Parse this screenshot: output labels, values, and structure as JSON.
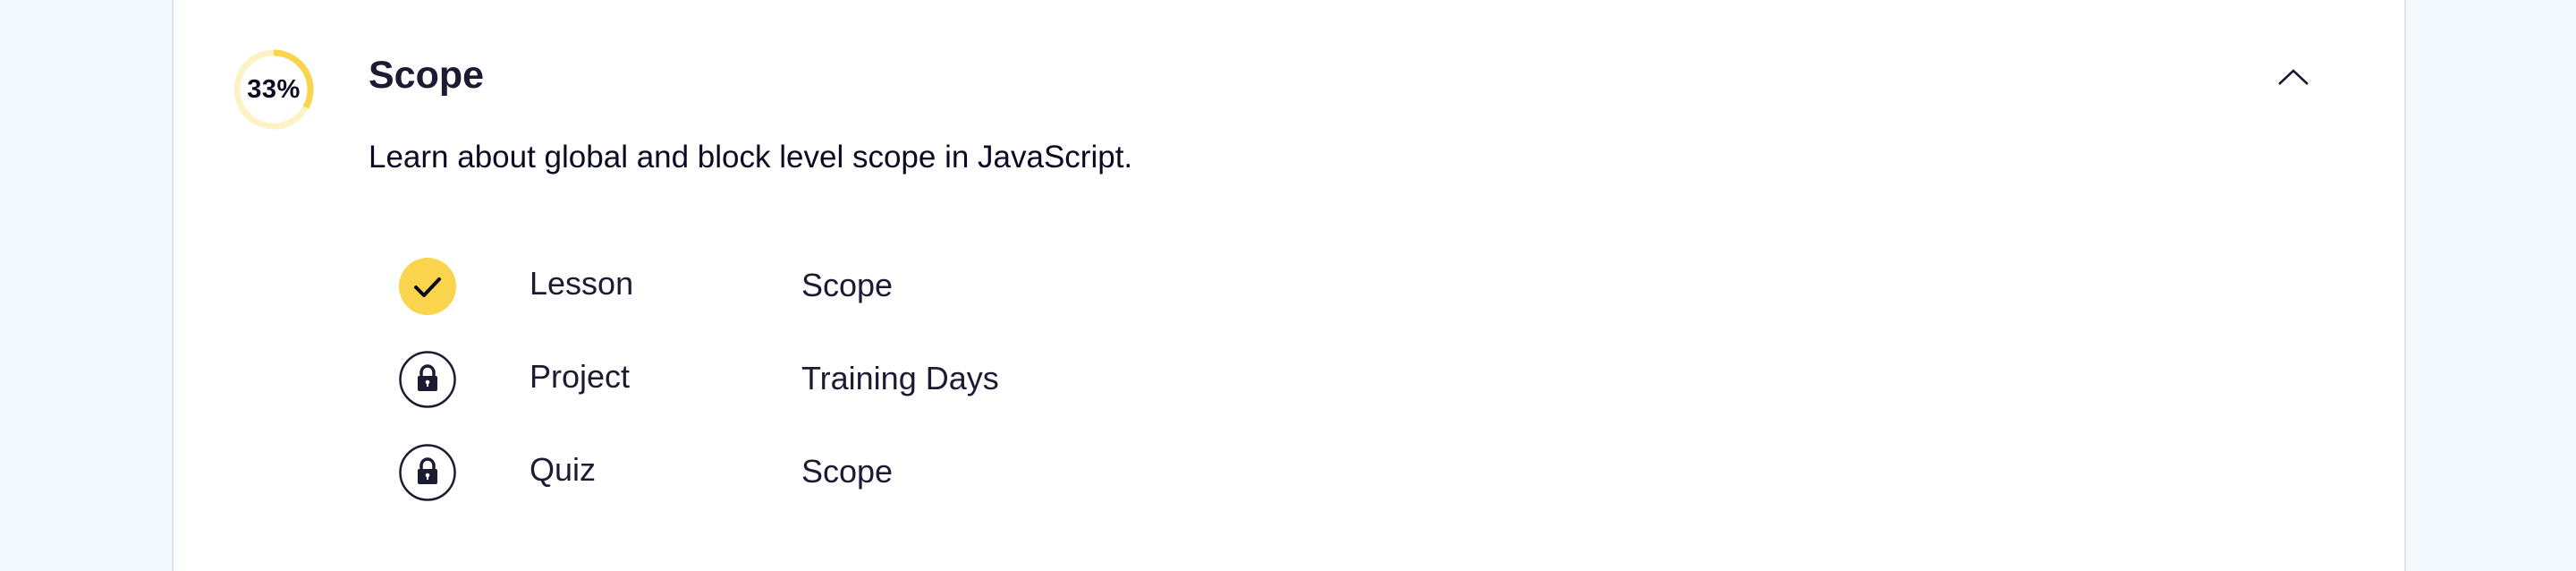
{
  "section": {
    "progress_label": "33%",
    "progress_fraction": 0.33,
    "title": "Scope",
    "description": "Learn about global and block level scope in JavaScript.",
    "collapse_icon": "chevron-up-icon"
  },
  "steps": [
    {
      "type": "Lesson",
      "name": "Scope",
      "status": "completed",
      "icon": "check-icon"
    },
    {
      "type": "Project",
      "name": "Training Days",
      "status": "locked",
      "icon": "lock-icon"
    },
    {
      "type": "Quiz",
      "name": "Scope",
      "status": "locked",
      "icon": "lock-icon"
    }
  ],
  "colors": {
    "accent": "#fad44c",
    "accent_light": "#fdf1c6",
    "text": "#1b1b32",
    "page_bg": "#f4f9fd",
    "card_bg": "#ffffff"
  }
}
